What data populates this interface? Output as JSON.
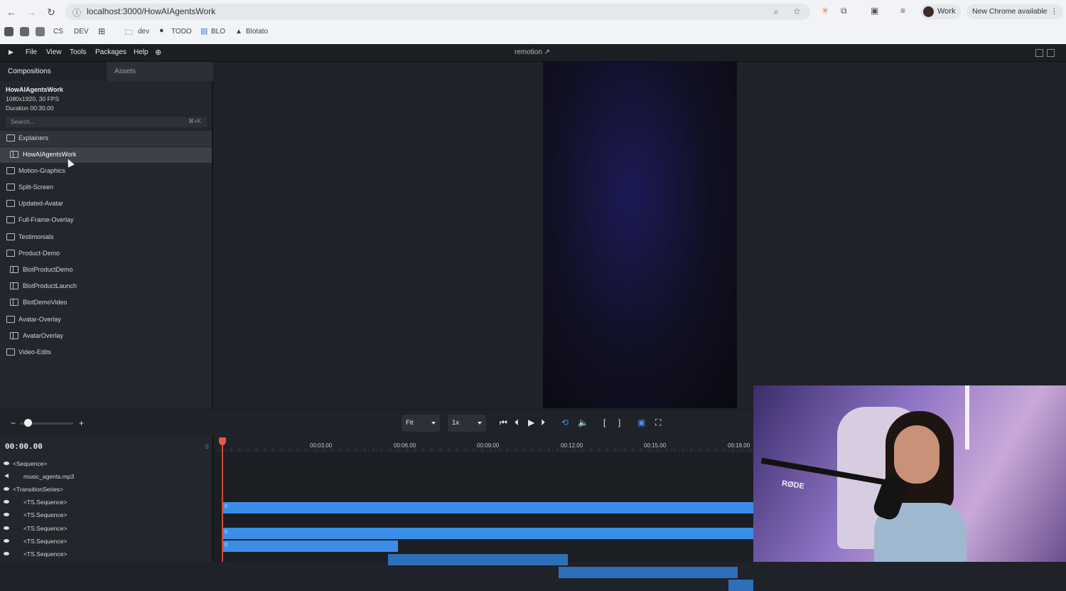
{
  "browser": {
    "url": "localhost:3000/HowAIAgentsWork",
    "profile_label": "Work",
    "update_label": "New Chrome available",
    "bookmarks": [
      "CS",
      "DEV",
      "dev",
      "TODO",
      "BLO",
      "Blotato"
    ]
  },
  "menubar": {
    "items": [
      "File",
      "View",
      "Tools",
      "Packages",
      "Help"
    ],
    "center_title": "remotion ↗"
  },
  "sidebar": {
    "tabs": [
      "Compositions",
      "Assets"
    ],
    "composition": {
      "name": "HowAIAgentsWork",
      "resolution": "1080x1920, 30 FPS",
      "duration": "Duration 00:30.00"
    },
    "search": {
      "placeholder": "Search...",
      "shortcut": "⌘+K"
    },
    "tree": [
      {
        "label": "Explainers",
        "type": "folder-open"
      },
      {
        "label": "HowAIAgentsWork",
        "type": "composition"
      },
      {
        "label": "Motion-Graphics",
        "type": "folder"
      },
      {
        "label": "Split-Screen",
        "type": "folder"
      },
      {
        "label": "Updated-Avatar",
        "type": "folder"
      },
      {
        "label": "Full-Frame-Overlay",
        "type": "folder"
      },
      {
        "label": "Testimonials",
        "type": "folder"
      },
      {
        "label": "Product-Demo",
        "type": "folder-open"
      },
      {
        "label": "BlotProductDemo",
        "type": "composition"
      },
      {
        "label": "BlotProductLaunch",
        "type": "composition"
      },
      {
        "label": "BlotDemoVideo",
        "type": "composition"
      },
      {
        "label": "Avatar-Overlay",
        "type": "folder-open"
      },
      {
        "label": "AvatarOverlay",
        "type": "composition"
      },
      {
        "label": "Video-Edits",
        "type": "folder"
      }
    ]
  },
  "controls": {
    "zoom_minus": "−",
    "zoom_plus": "+",
    "zoom_level": 0.15,
    "fit_label": "Fit",
    "rate_label": "1x"
  },
  "timeline": {
    "timecode": "00:00.00",
    "current_frame": "0",
    "ticks": [
      "00:03.00",
      "00:06.00",
      "00:09.00",
      "00:12.00",
      "00:15.00",
      "00:18.00"
    ],
    "tracks": [
      {
        "name": "<Sequence>",
        "icon": "eye-icon",
        "indent": 0
      },
      {
        "name": "music_agents.mp3",
        "icon": "speaker-icon",
        "indent": 1
      },
      {
        "name": "<TransitionSeries>",
        "icon": "eye-icon",
        "indent": 0
      },
      {
        "name": "<TS.Sequence>",
        "icon": "eye-icon",
        "indent": 1
      },
      {
        "name": "<TS.Sequence>",
        "icon": "eye-icon",
        "indent": 1
      },
      {
        "name": "<TS.Sequence>",
        "icon": "eye-icon",
        "indent": 1
      },
      {
        "name": "<TS.Sequence>",
        "icon": "eye-icon",
        "indent": 1
      },
      {
        "name": "<TS.Sequence>",
        "icon": "eye-icon",
        "indent": 1
      }
    ],
    "bar_frame_label": "0"
  }
}
